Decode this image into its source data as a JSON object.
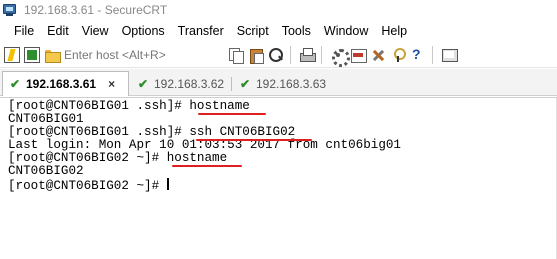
{
  "window": {
    "title": "192.168.3.61 - SecureCRT"
  },
  "menu": {
    "items": [
      "File",
      "Edit",
      "View",
      "Options",
      "Transfer",
      "Script",
      "Tools",
      "Window",
      "Help"
    ]
  },
  "toolbar": {
    "host_placeholder": "Enter host <Alt+R>",
    "icons": [
      "connect-icon",
      "quick-connect-icon",
      "connect-in-tab-icon",
      "copy-icon",
      "paste-icon",
      "find-icon",
      "print-icon",
      "session-options-icon",
      "sftp-icon",
      "options-icon",
      "keymap-icon",
      "help-icon",
      "screen-icon"
    ]
  },
  "tabs": [
    {
      "label": "192.168.3.61",
      "active": true,
      "status_icon": "check-icon",
      "close_label": "×"
    },
    {
      "label": "192.168.3.62",
      "active": false,
      "status_icon": "check-icon"
    },
    {
      "label": "192.168.3.63",
      "active": false,
      "status_icon": "check-icon"
    }
  ],
  "terminal": {
    "lines": [
      "[root@CNT06BIG01 .ssh]# hostname",
      "CNT06BIG01",
      "[root@CNT06BIG01 .ssh]# ssh CNT06BIG02",
      "Last login: Mon Apr 10 01:03:53 2017 from cnt06big01",
      "[root@CNT06BIG02 ~]# hostname",
      "CNT06BIG02",
      "[root@CNT06BIG02 ~]# "
    ],
    "annotation_color": "#e02020"
  },
  "colors": {
    "tab_check": "#2e8b2e",
    "annotation": "#e02020",
    "title_text": "#888888"
  }
}
